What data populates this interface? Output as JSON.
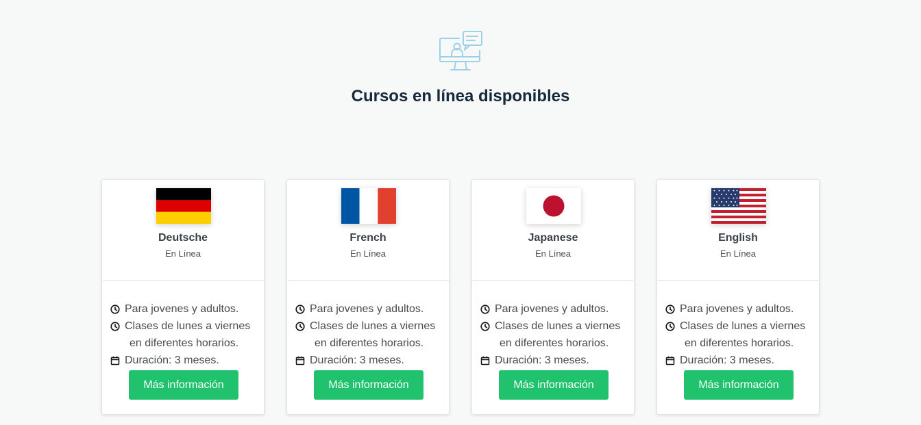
{
  "header": {
    "icon": "online-class-monitor-icon",
    "title": "Cursos en línea disponibles"
  },
  "courses": [
    {
      "name": "Deutsche",
      "mode": "En Línea",
      "flag": "germany-flag",
      "features": [
        "Para jovenes y adultos.",
        "Clases de lunes a viernes",
        "en diferentes horarios.",
        "Duración: 3 meses."
      ],
      "button": "Más información"
    },
    {
      "name": "French",
      "mode": "En Línea",
      "flag": "france-flag",
      "features": [
        "Para jovenes y adultos.",
        "Clases de lunes a viernes",
        "en diferentes horarios.",
        "Duración: 3 meses."
      ],
      "button": "Más información"
    },
    {
      "name": "Japanese",
      "mode": "En Línea",
      "flag": "japan-flag",
      "features": [
        "Para jovenes y adultos.",
        "Clases de lunes a viernes",
        "en diferentes horarios.",
        "Duración: 3 meses."
      ],
      "button": "Más información"
    },
    {
      "name": "English",
      "mode": "En Línea",
      "flag": "usa-flag",
      "features": [
        "Para jovenes y adultos.",
        "Clases de lunes a viernes",
        "en diferentes horarios.",
        "Duración: 3 meses."
      ],
      "button": "Más información"
    }
  ],
  "colors": {
    "accent_button": "#20c26e",
    "title": "#15293a",
    "icon_line": "#9ed0e6"
  }
}
